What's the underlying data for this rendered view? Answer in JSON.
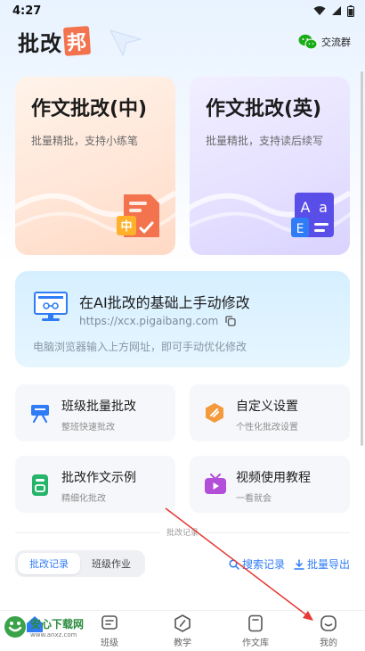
{
  "status_bar": {
    "time": "4:27"
  },
  "header": {
    "logo_text_main": "批改",
    "logo_text_last": "邦",
    "group_chat_label": "交流群"
  },
  "cards": [
    {
      "title": "作文批改(中)",
      "subtitle": "批量精批，支持小练笔",
      "icon_glyph": "中"
    },
    {
      "title": "作文批改(英)",
      "subtitle": "批量精批，支持读后续写",
      "icon_glyph_a": "A",
      "icon_glyph_b": "a",
      "icon_glyph_c": "E"
    }
  ],
  "ai_banner": {
    "title": "在AI批改的基础上手动修改",
    "url": "https://xcx.pigaibang.com",
    "hint": "电脑浏览器输入上方网址，即可手动优化修改"
  },
  "tiles": [
    {
      "title": "班级批量批改",
      "subtitle": "整班快速批改"
    },
    {
      "title": "自定义设置",
      "subtitle": "个性化批改设置"
    },
    {
      "title": "批改作文示例",
      "subtitle": "精细化批改"
    },
    {
      "title": "视频使用教程",
      "subtitle": "一看就会"
    }
  ],
  "section_label": "批改记录",
  "segmented": {
    "options": [
      "批改记录",
      "班级作业"
    ],
    "active_index": 0
  },
  "actions": {
    "search": "搜索记录",
    "export": "批量导出"
  },
  "tabbar": {
    "items": [
      "班级",
      "教学",
      "作文库",
      "我的"
    ]
  },
  "watermark": {
    "name": "安心下载网",
    "url": "www.anxz.com"
  },
  "colors": {
    "accent": "#2f7cf6",
    "orange": "#f3734e",
    "purple": "#5a4ee8"
  }
}
